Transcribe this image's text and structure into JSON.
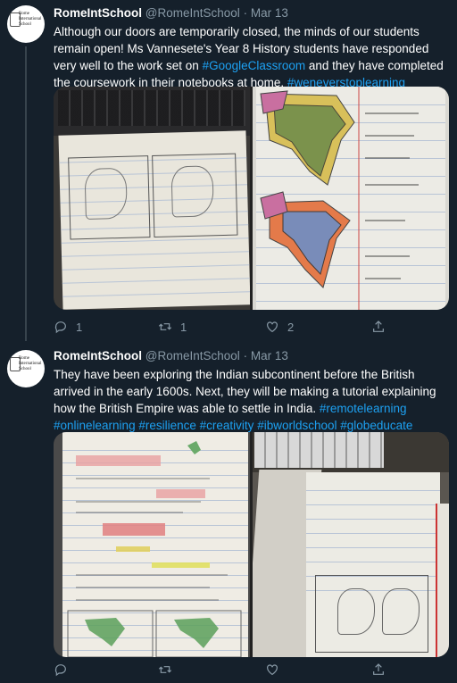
{
  "tweets": [
    {
      "name": "RomeIntSchool",
      "handle": "@RomeIntSchool",
      "date": "Mar 13",
      "avatar_text": "Rome International School",
      "text_parts": [
        {
          "t": "Although our doors are temporarily closed, the minds of our students remain open! Ms Vannesete's Year 8 History students have responded very well to the work set on ",
          "link": false
        },
        {
          "t": "#GoogleClassroom",
          "link": true
        },
        {
          "t": " and they have completed the coursework in their notebooks at home. ",
          "link": false
        },
        {
          "t": "#weneverstoplearning",
          "link": true
        }
      ],
      "replies": "1",
      "retweets": "1",
      "likes": "2"
    },
    {
      "name": "RomeIntSchool",
      "handle": "@RomeIntSchool",
      "date": "Mar 13",
      "avatar_text": "Rome International School",
      "text_parts": [
        {
          "t": "They have been exploring the Indian subcontinent before the British arrived in the early 1600s. Next, they will be making a tutorial explaining how the British Empire was able to settle in India. ",
          "link": false
        },
        {
          "t": "#remotelearning",
          "link": true
        },
        {
          "t": " ",
          "link": false
        },
        {
          "t": "#onlinelearning",
          "link": true
        },
        {
          "t": " ",
          "link": false
        },
        {
          "t": "#resilience",
          "link": true
        },
        {
          "t": " ",
          "link": false
        },
        {
          "t": "#creativity",
          "link": true
        },
        {
          "t": " ",
          "link": false
        },
        {
          "t": "#ibworldschool",
          "link": true
        },
        {
          "t": " ",
          "link": false
        },
        {
          "t": "#globeducate",
          "link": true
        }
      ],
      "replies": "",
      "retweets": "",
      "likes": ""
    }
  ],
  "separator": "·",
  "icons": {
    "reply": "reply-icon",
    "retweet": "retweet-icon",
    "like": "like-icon",
    "share": "share-icon"
  },
  "colors": {
    "background": "#15202b",
    "link": "#1da1f2",
    "muted": "#8899a6",
    "border": "#38444d"
  }
}
